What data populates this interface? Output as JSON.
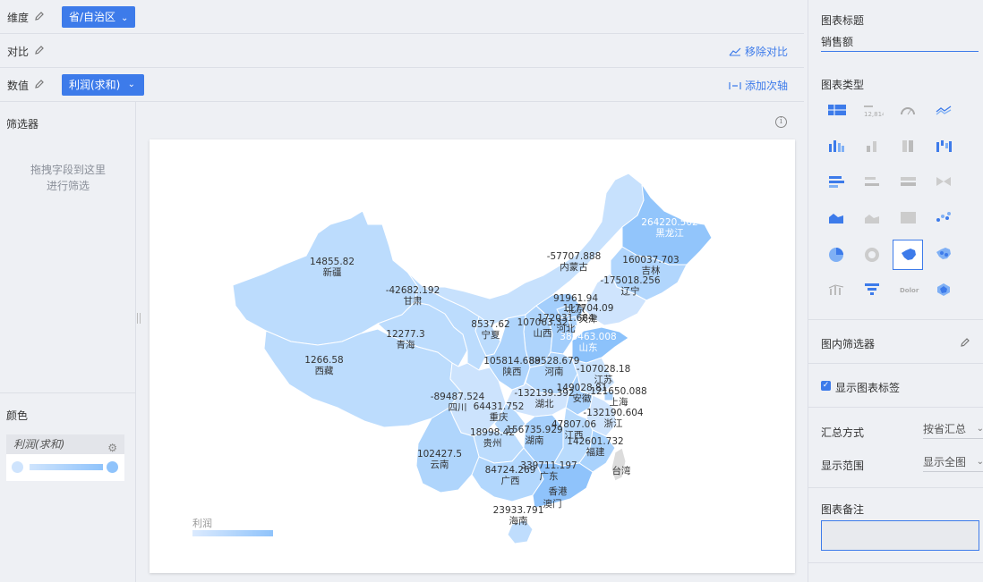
{
  "config": {
    "dimension": {
      "label": "维度",
      "chip": "省/自治区"
    },
    "compare": {
      "label": "对比",
      "action": "移除对比"
    },
    "value": {
      "label": "数值",
      "chip": "利润(求和)",
      "action": "添加次轴"
    }
  },
  "left": {
    "filter_title": "筛选器",
    "filter_hint_1": "拖拽字段到这里",
    "filter_hint_2": "进行筛选",
    "color_title": "颜色",
    "color_field": "利润(求和)"
  },
  "chart": {
    "legend_title": "利润",
    "info_icon": "info-icon"
  },
  "chart_data": {
    "type": "map",
    "region": "China provinces",
    "measure": "利润",
    "regions": [
      {
        "name": "黑龙江",
        "value": 264220.502
      },
      {
        "name": "吉林",
        "value": 160037.703
      },
      {
        "name": "辽宁",
        "value": -175018.256
      },
      {
        "name": "内蒙古",
        "value": -57707.888
      },
      {
        "name": "新疆",
        "value": 14855.82
      },
      {
        "name": "甘肃",
        "value": -42682.192
      },
      {
        "name": "青海",
        "value": 12277.3
      },
      {
        "name": "西藏",
        "value": 1266.58
      },
      {
        "name": "宁夏",
        "value": 8537.62
      },
      {
        "name": "山西",
        "value": 107063.32
      },
      {
        "name": "河北",
        "value": 172031.684
      },
      {
        "name": "北京",
        "value": 91961.94
      },
      {
        "name": "天津",
        "value": 117704.09
      },
      {
        "name": "山东",
        "value": 385463.008
      },
      {
        "name": "陕西",
        "value": 105814.688
      },
      {
        "name": "河南",
        "value": 89528.679
      },
      {
        "name": "江苏",
        "value": -107028.18
      },
      {
        "name": "安徽",
        "value": 149028.81
      },
      {
        "name": "上海",
        "value": 121650.088
      },
      {
        "name": "湖北",
        "value": -132139.392
      },
      {
        "name": "浙江",
        "value": -132190.604
      },
      {
        "name": "四川",
        "value": -89487.524
      },
      {
        "name": "重庆",
        "value": 64431.752
      },
      {
        "name": "贵州",
        "value": 18998.42
      },
      {
        "name": "湖南",
        "value": 156735.929
      },
      {
        "name": "江西",
        "value": 47807.06
      },
      {
        "name": "福建",
        "value": 142601.732
      },
      {
        "name": "云南",
        "value": 102427.5
      },
      {
        "name": "广西",
        "value": 84724.269
      },
      {
        "name": "广东",
        "value": 339711.197
      },
      {
        "name": "香港",
        "value": null
      },
      {
        "name": "澳门",
        "value": null
      },
      {
        "name": "海南",
        "value": 23933.791
      },
      {
        "name": "台湾",
        "value": null
      }
    ],
    "color_min": "#dbeafe",
    "color_max": "#8fc3fb"
  },
  "right": {
    "title_label": "图表标题",
    "title_value": "销售额",
    "type_label": "图表类型",
    "inner_filter_label": "图内筛选器",
    "show_labels": "显示图表标签",
    "agg_label": "汇总方式",
    "agg_value": "按省汇总",
    "range_label": "显示范围",
    "range_value": "显示全图",
    "note_label": "图表备注",
    "type_big_number": "12,814",
    "type_wordcloud": "Dolor"
  }
}
